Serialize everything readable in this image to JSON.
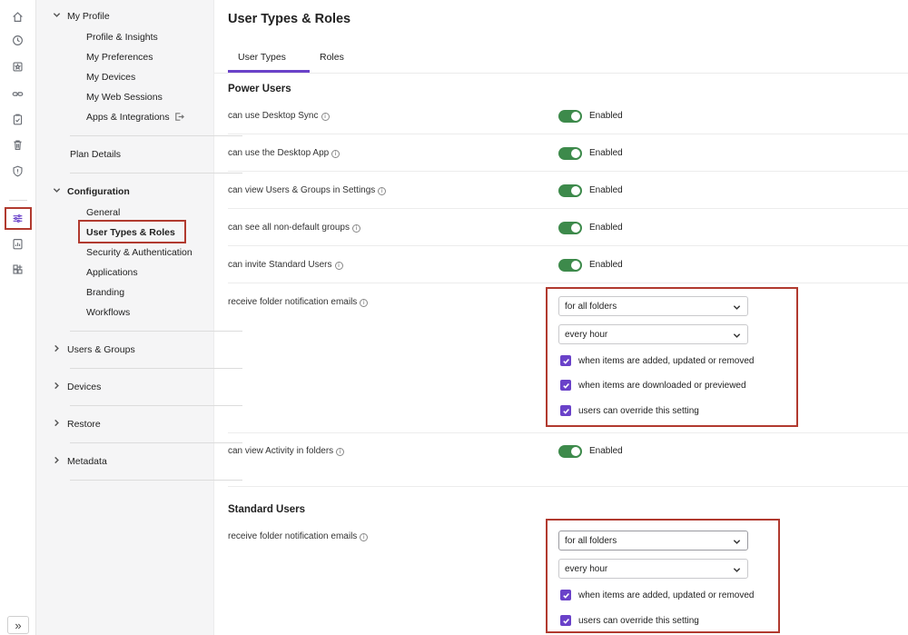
{
  "sidebar": {
    "groups": {
      "my_profile": {
        "label": "My Profile",
        "items": [
          "Profile & Insights",
          "My Preferences",
          "My Devices",
          "My Web Sessions",
          "Apps & Integrations"
        ]
      },
      "plan_details": {
        "label": "Plan Details"
      },
      "configuration": {
        "label": "Configuration",
        "items": [
          "General",
          "User Types & Roles",
          "Security & Authentication",
          "Applications",
          "Branding",
          "Workflows"
        ]
      },
      "users_groups": {
        "label": "Users & Groups"
      },
      "devices": {
        "label": "Devices"
      },
      "restore": {
        "label": "Restore"
      },
      "metadata": {
        "label": "Metadata"
      }
    },
    "expand_label": "»"
  },
  "main": {
    "title": "User Types & Roles",
    "tabs": [
      "User Types",
      "Roles"
    ],
    "active_tab": "User Types",
    "power_users": {
      "title": "Power Users",
      "toggles": [
        {
          "label": "can use Desktop Sync",
          "state": "Enabled"
        },
        {
          "label": "can use the Desktop App",
          "state": "Enabled"
        },
        {
          "label": "can view Users & Groups in Settings",
          "state": "Enabled"
        },
        {
          "label": "can see all non-default groups",
          "state": "Enabled"
        },
        {
          "label": "can invite Standard Users",
          "state": "Enabled"
        }
      ],
      "notifications": {
        "label": "receive folder notification emails",
        "scope": "for all folders",
        "frequency": "every hour",
        "checks": [
          "when items are added, updated or removed",
          "when items are downloaded or previewed",
          "users can override this setting"
        ]
      },
      "activity": {
        "label": "can view Activity in folders",
        "state": "Enabled"
      }
    },
    "standard_users": {
      "title": "Standard Users",
      "notifications": {
        "label": "receive folder notification emails",
        "scope": "for all folders",
        "frequency": "every hour",
        "checks": [
          "when items are added, updated or removed",
          "users can override this setting"
        ]
      }
    },
    "info_glyph": "i"
  },
  "colors": {
    "accent": "#6a42c9",
    "toggle_on": "#3d8a4b",
    "highlight": "#b13a2f"
  }
}
